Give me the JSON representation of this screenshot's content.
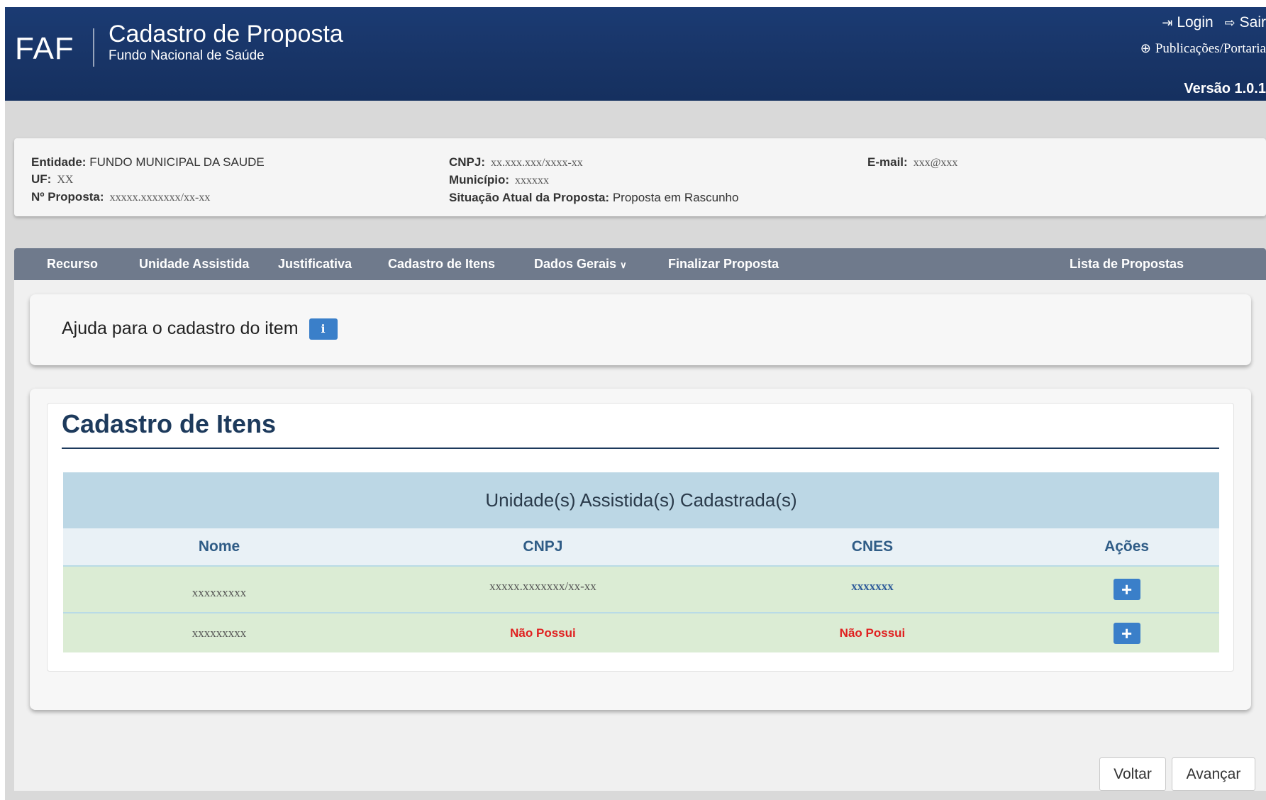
{
  "header": {
    "logo": "FAF",
    "title": "Cadastro de Proposta",
    "subtitle": "Fundo Nacional de Saúde",
    "login_label": "Login",
    "logout_label": "Sair",
    "publications_label": "Publicações/Portaria",
    "version": "Versão 1.0.1"
  },
  "info": {
    "entidade_label": "Entidade:",
    "entidade_value": "FUNDO MUNICIPAL DA SAUDE",
    "uf_label": "UF:",
    "uf_value": "XX",
    "proposta_label": "Nº Proposta:",
    "proposta_value": "xxxxx.xxxxxxx/xx-xx",
    "cnpj_label": "CNPJ:",
    "cnpj_value": "xx.xxx.xxx/xxxx-xx",
    "municipio_label": "Município:",
    "municipio_value": "xxxxxx",
    "situacao_label": "Situação Atual da Proposta:",
    "situacao_value": "Proposta em Rascunho",
    "email_label": "E-mail:",
    "email_value": "xxx@xxx"
  },
  "nav": {
    "recurso": "Recurso",
    "unidade": "Unidade Assistida",
    "justificativa": "Justificativa",
    "cadastro_itens": "Cadastro de Itens",
    "dados_gerais": "Dados Gerais",
    "finalizar": "Finalizar Proposta",
    "lista": "Lista de Propostas"
  },
  "help": {
    "text": "Ajuda para o cadastro do item",
    "icon": "info-icon"
  },
  "section": {
    "title": "Cadastro de Itens",
    "table_caption": "Unidade(s) Assistida(s) Cadastrada(s)",
    "columns": [
      "Nome",
      "CNPJ",
      "CNES",
      "Ações"
    ],
    "rows": [
      {
        "nome": "xxxxxxxxx",
        "cnpj": "xxxxx.xxxxxxx/xx-xx",
        "cnes": "xxxxxxx"
      },
      {
        "nome": "xxxxxxxxx",
        "cnpj": "Não Possui",
        "cnes": "Não Possui"
      }
    ]
  },
  "buttons": {
    "voltar": "Voltar",
    "avancar": "Avançar"
  },
  "colors": {
    "header": "#1b3b73",
    "nav": "#6f7a8c",
    "accent_blue": "#3a7fc9",
    "row_green": "#dbecd4",
    "caption_blue": "#bcd7e5",
    "error_red": "#e02020"
  }
}
